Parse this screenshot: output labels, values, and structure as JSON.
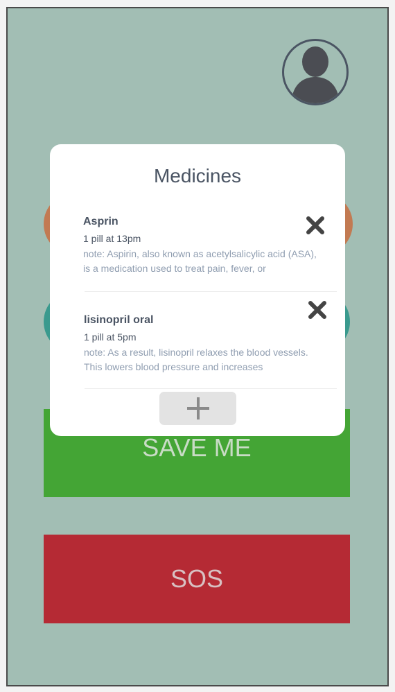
{
  "modal": {
    "title": "Medicines",
    "add_icon": "plus-icon",
    "medicines": [
      {
        "name": "Asprin",
        "dose": "1 pill at 13pm",
        "note": "note: Aspirin, also known as acetylsalicylic acid (ASA), is a medication used to treat pain, fever, or",
        "remove_icon": "close-icon"
      },
      {
        "name": "lisinopril oral",
        "dose": "1 pill at 5pm",
        "note": "note: As a result, lisinopril relaxes the blood vessels. This lowers blood pressure and increases",
        "remove_icon": "close-icon"
      }
    ]
  },
  "buttons": {
    "save_label": "SAVE ME",
    "sos_label": "SOS"
  },
  "profile": {
    "icon": "user-avatar-icon"
  },
  "colors": {
    "background": "#a2beb4",
    "save": "#44a535",
    "sos": "#b52a34",
    "orange_circle": "#c27a52",
    "teal_circle": "#3a9a8e",
    "text_dark": "#4a5463",
    "text_muted": "#8f9db0"
  }
}
